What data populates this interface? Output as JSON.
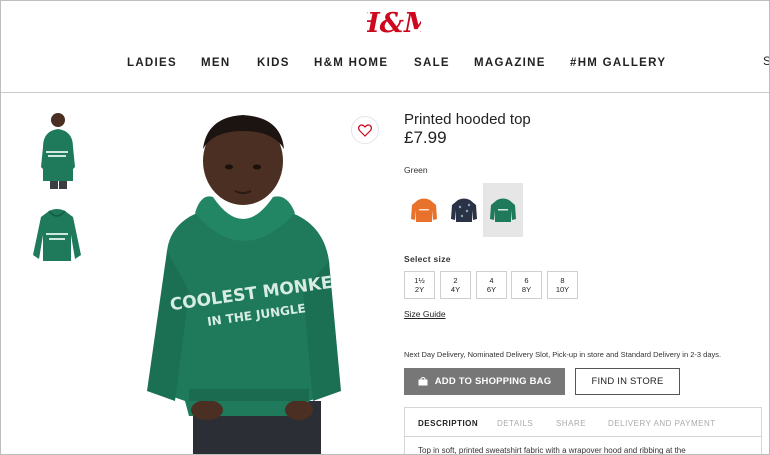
{
  "header": {
    "logo_text": "H&M",
    "nav": [
      {
        "label": "LADIES"
      },
      {
        "label": "MEN"
      },
      {
        "label": "KIDS"
      },
      {
        "label": "H&M HOME"
      },
      {
        "label": "SALE"
      },
      {
        "label": "MAGAZINE"
      },
      {
        "label": "#HM GALLERY"
      }
    ],
    "nav_cut": "S"
  },
  "product": {
    "title": "Printed hooded top",
    "price": "£7.99",
    "color_label": "Green",
    "swatches": [
      {
        "name": "orange",
        "color": "#e8712b"
      },
      {
        "name": "navy-pattern",
        "color": "#2a3346"
      },
      {
        "name": "green",
        "color": "#1d7a5a",
        "selected": true
      }
    ],
    "size_label": "Select size",
    "sizes": [
      {
        "top": "1½",
        "bottom": "2Y"
      },
      {
        "top": "2",
        "bottom": "4Y"
      },
      {
        "top": "4",
        "bottom": "6Y"
      },
      {
        "top": "6",
        "bottom": "8Y"
      },
      {
        "top": "8",
        "bottom": "10Y"
      }
    ],
    "size_guide": "Size Guide",
    "delivery_note": "Next Day Delivery, Nominated Delivery Slot, Pick-up in store and Standard Delivery in 2-3 days.",
    "add_to_bag": "ADD TO SHOPPING BAG",
    "find_in_store": "FIND IN STORE",
    "tabs": [
      {
        "label": "DESCRIPTION",
        "active": true
      },
      {
        "label": "DETAILS"
      },
      {
        "label": "SHARE"
      },
      {
        "label": "DELIVERY AND PAYMENT"
      }
    ],
    "description": "Top in soft, printed sweatshirt fabric with a wrapover hood and ribbing at the",
    "print_text_line1": "COOLEST MONKE",
    "print_text_line2": "IN THE JUNGLE",
    "thumb_print_line1": "COOLEST MONKE",
    "thumb_print_line2": "IN THE JUNGLE"
  },
  "colors": {
    "brand_red": "#cc071e",
    "hoodie_green": "#1f7a5c",
    "button_grey": "#777777"
  }
}
